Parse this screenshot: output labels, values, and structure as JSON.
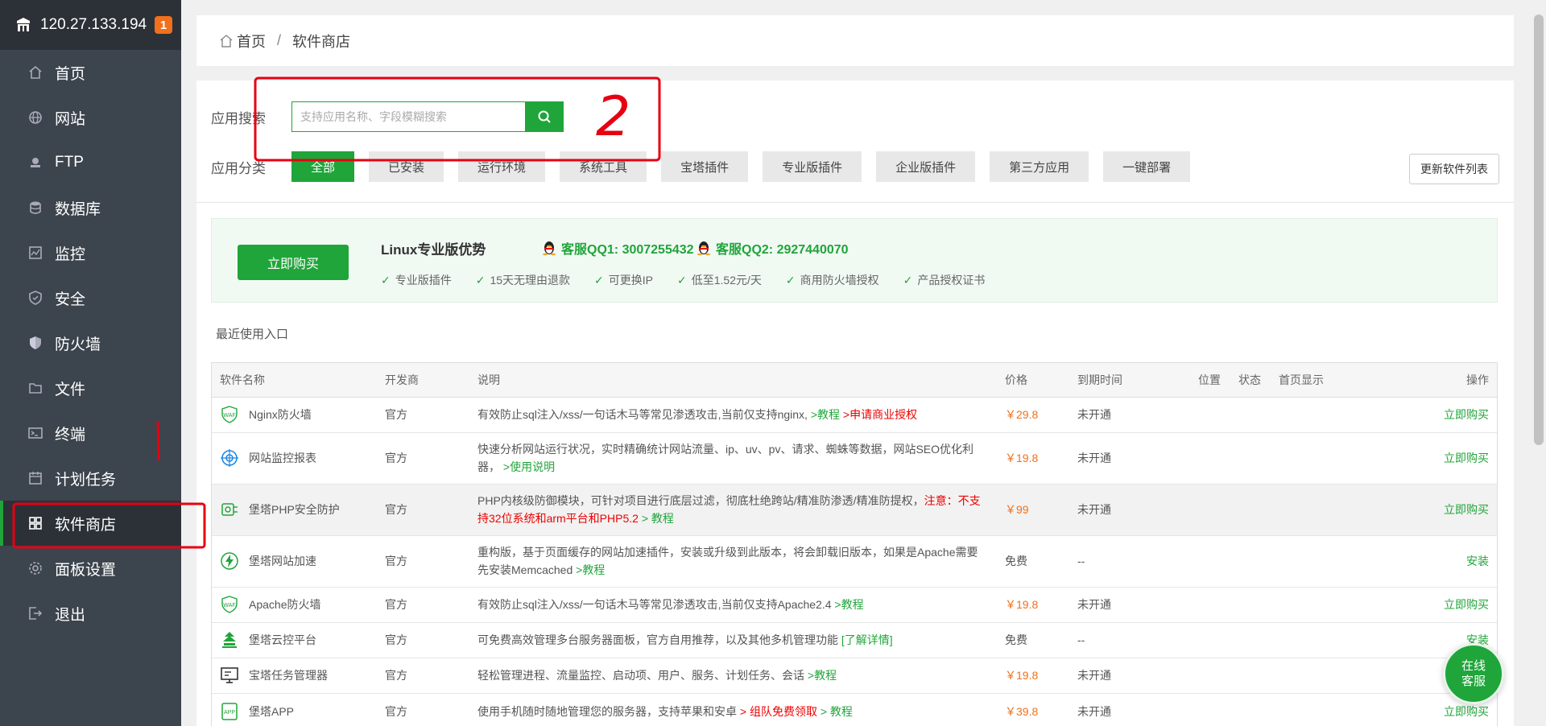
{
  "sidebar": {
    "ip": "120.27.133.194",
    "badge": "1",
    "items": [
      {
        "label": "首页",
        "icon": "home-icon"
      },
      {
        "label": "网站",
        "icon": "globe-icon"
      },
      {
        "label": "FTP",
        "icon": "ftp-icon"
      },
      {
        "label": "数据库",
        "icon": "database-icon"
      },
      {
        "label": "监控",
        "icon": "monitor-icon"
      },
      {
        "label": "安全",
        "icon": "shield-check-icon"
      },
      {
        "label": "防火墙",
        "icon": "firewall-icon"
      },
      {
        "label": "文件",
        "icon": "folder-icon"
      },
      {
        "label": "终端",
        "icon": "terminal-icon"
      },
      {
        "label": "计划任务",
        "icon": "calendar-icon"
      },
      {
        "label": "软件商店",
        "icon": "grid-icon",
        "active": true
      },
      {
        "label": "面板设置",
        "icon": "gear-icon"
      },
      {
        "label": "退出",
        "icon": "logout-icon"
      }
    ]
  },
  "breadcrumb": {
    "home": "首页",
    "separator": "/",
    "current": "软件商店"
  },
  "search": {
    "label": "应用搜索",
    "placeholder": "支持应用名称、字段模糊搜索",
    "value": ""
  },
  "category": {
    "label": "应用分类",
    "items": [
      "全部",
      "已安装",
      "运行环境",
      "系统工具",
      "宝塔插件",
      "专业版插件",
      "企业版插件",
      "第三方应用",
      "一键部署"
    ],
    "active": "全部"
  },
  "update_button": "更新软件列表",
  "promo": {
    "buy_button": "立即购买",
    "title": "Linux专业版优势",
    "qq1": "客服QQ1: 3007255432",
    "qq2": "客服QQ2: 2927440070",
    "features": [
      "专业版插件",
      "15天无理由退款",
      "可更换IP",
      "低至1.52元/天",
      "商用防火墙授权",
      "产品授权证书"
    ]
  },
  "recent_label": "最近使用入口",
  "table": {
    "headers": [
      "软件名称",
      "开发商",
      "说明",
      "价格",
      "到期时间",
      "位置",
      "状态",
      "首页显示",
      "操作"
    ],
    "rows": [
      {
        "name": "Nginx防火墙",
        "icon": "waf-icon",
        "dev": "官方",
        "desc": "有效防止sql注入/xss/一句话木马等常见渗透攻击,当前仅支持nginx, ",
        "link1": ">教程",
        "link2": ">申请商业授权",
        "price": "￥29.8",
        "expire": "未开通",
        "op": "立即购买"
      },
      {
        "name": "网站监控报表",
        "icon": "monitor-report-icon",
        "dev": "官方",
        "desc": "快速分析网站运行状况，实时精确统计网站流量、ip、uv、pv、请求、蜘蛛等数据，网站SEO优化利器，",
        "link1": ">使用说明",
        "price": "￥19.8",
        "expire": "未开通",
        "op": "立即购买"
      },
      {
        "name": "堡塔PHP安全防护",
        "icon": "php-guard-icon",
        "dev": "官方",
        "desc": "PHP内核级防御模块，可针对项目进行底层过滤，彻底杜绝跨站/精准防渗透/精准防提权，",
        "warn": "注意：不支持32位系统和arm平台和PHP5.2",
        "link1": "> 教程",
        "price": "￥99",
        "expire": "未开通",
        "op": "立即购买"
      },
      {
        "name": "堡塔网站加速",
        "icon": "lightning-icon",
        "dev": "官方",
        "desc": "重构版，基于页面缓存的网站加速插件，安装或升级到此版本，将会卸载旧版本，如果是Apache需要先安装Memcached ",
        "link1": ">教程",
        "price": "免费",
        "expire": "--",
        "op": "安装"
      },
      {
        "name": "Apache防火墙",
        "icon": "waf-icon",
        "dev": "官方",
        "desc": "有效防止sql注入/xss/一句话木马等常见渗透攻击,当前仅支持Apache2.4 ",
        "link1": ">教程",
        "price": "￥19.8",
        "expire": "未开通",
        "op": "立即购买"
      },
      {
        "name": "堡塔云控平台",
        "icon": "cloud-control-icon",
        "dev": "官方",
        "desc": "可免费高效管理多台服务器面板，官方自用推荐，以及其他多机管理功能 ",
        "link1": "[了解详情]",
        "price": "免费",
        "expire": "--",
        "op": "安装"
      },
      {
        "name": "宝塔任务管理器",
        "icon": "task-manager-icon",
        "dev": "官方",
        "desc": "轻松管理进程、流量监控、启动项、用户、服务、计划任务、会话 ",
        "link1": ">教程",
        "price": "￥19.8",
        "expire": "未开通",
        "op": "立即购买"
      },
      {
        "name": "堡塔APP",
        "icon": "app-icon",
        "dev": "官方",
        "desc": "使用手机随时随地管理您的服务器，支持苹果和安卓 ",
        "link2": "> 组队免费领取",
        "link1": " > 教程",
        "price": "￥39.8",
        "expire": "未开通",
        "op": "立即购买"
      }
    ]
  },
  "float_service": {
    "line1": "在线",
    "line2": "客服"
  },
  "annotation": {
    "number": "2"
  },
  "colors": {
    "accent": "#20a53a",
    "sidebar_bg": "#3c444d",
    "sidebar_top": "#2c3138",
    "price": "#f0701c",
    "badge": "#f0701c",
    "annotation": "#e60012"
  }
}
